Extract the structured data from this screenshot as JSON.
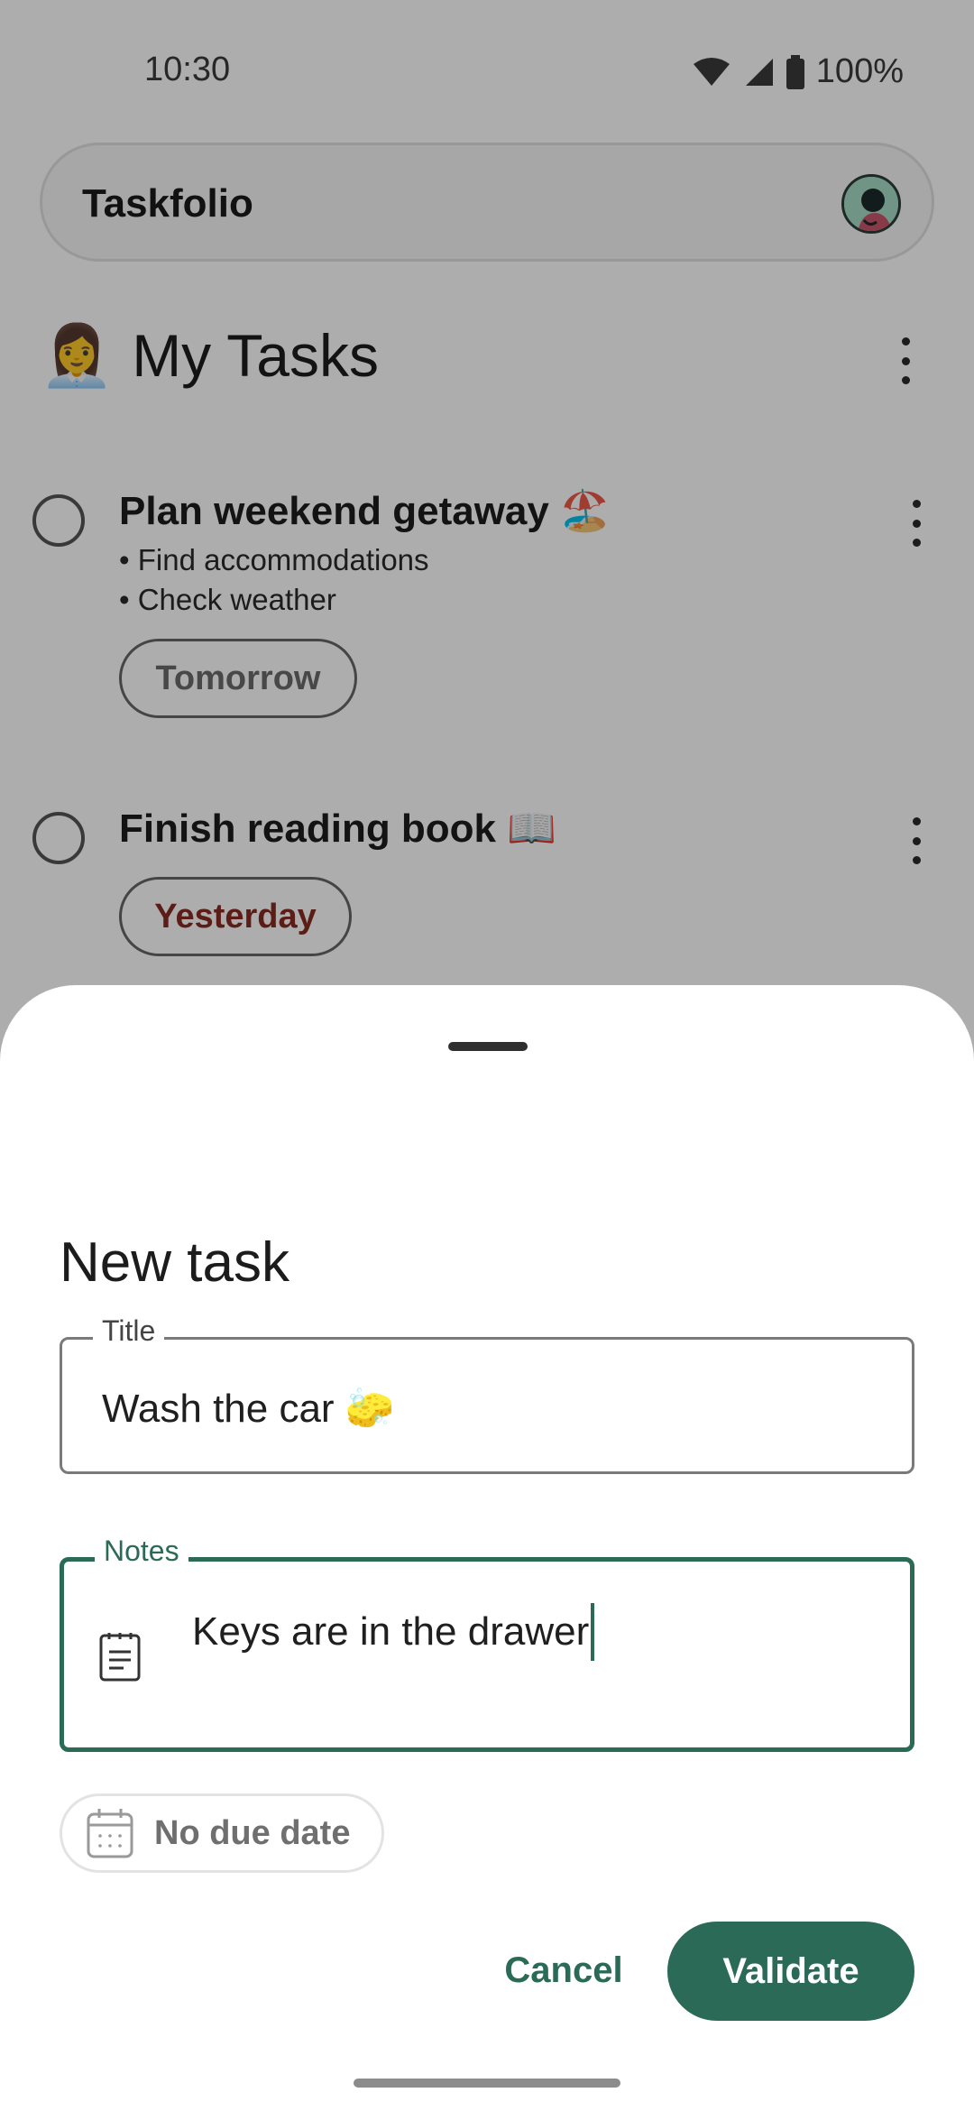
{
  "status_bar": {
    "time": "10:30",
    "battery": "100%",
    "icons": [
      "wifi-icon",
      "cell-signal-icon",
      "battery-icon"
    ]
  },
  "app_bar": {
    "title": "Taskfolio",
    "avatar": "avatar"
  },
  "list": {
    "emoji": "👩‍💼",
    "title": "My Tasks"
  },
  "tasks": [
    {
      "title": "Plan weekend getaway 🏖️",
      "notes": [
        "• Find accommodations",
        "• Check weather"
      ],
      "due": "Tomorrow",
      "due_color": "#6a6a6a"
    },
    {
      "title": "Finish reading book 📖",
      "notes": [],
      "due": "Yesterday",
      "due_color": "#8a2c22"
    }
  ],
  "sheet": {
    "title": "New task",
    "title_field": {
      "label": "Title",
      "value": "Wash the car 🧽"
    },
    "notes_field": {
      "label": "Notes",
      "value": "Keys are in the drawer"
    },
    "due_chip": "No due date",
    "cancel_label": "Cancel",
    "validate_label": "Validate"
  },
  "colors": {
    "accent": "#2b6a57",
    "overdue": "#8a2c22",
    "scrim": "rgba(0,0,0,0.32)"
  }
}
